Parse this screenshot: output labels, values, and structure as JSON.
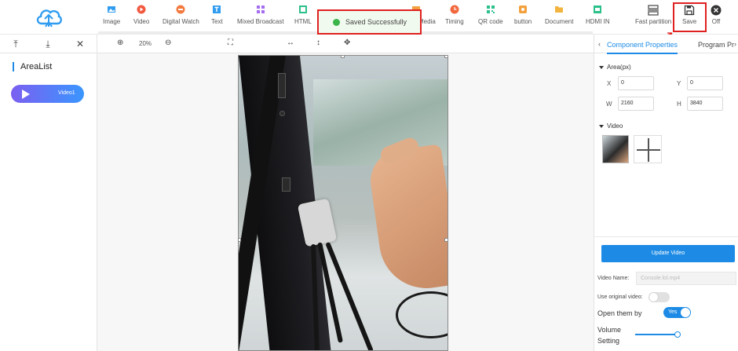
{
  "toolbar": {
    "items": [
      {
        "label": "Image",
        "icon": "image-icon",
        "color": "#2f9cf0"
      },
      {
        "label": "Video",
        "icon": "video-icon",
        "color": "#f2583e"
      },
      {
        "label": "Digital Watch",
        "icon": "digital-watch-icon",
        "color": "#f27a3e"
      },
      {
        "label": "Text",
        "icon": "text-icon",
        "color": "#2f9cf0"
      },
      {
        "label": "Mixed Broadcast",
        "icon": "mixed-broadcast-icon",
        "color": "#a66df0"
      },
      {
        "label": "HTML",
        "icon": "html-icon",
        "color": "#2cc08a"
      },
      {
        "label": "Stream Media",
        "icon": "stream-media-icon",
        "color": "#f2a13e"
      },
      {
        "label": "Timing",
        "icon": "timing-icon",
        "color": "#f2683e"
      },
      {
        "label": "QR code",
        "icon": "qr-code-icon",
        "color": "#2cc08a"
      },
      {
        "label": "button",
        "icon": "button-icon",
        "color": "#f2a13e"
      },
      {
        "label": "Document",
        "icon": "document-icon",
        "color": "#f2b43e"
      },
      {
        "label": "HDMI IN",
        "icon": "hdmi-in-icon",
        "color": "#2cc08a"
      }
    ],
    "fast_partition": "Fast partition",
    "save": "Save",
    "off": "Off"
  },
  "toast": {
    "message": "Saved Successfully"
  },
  "left_panel": {
    "title": "AreaList",
    "item": "Video1"
  },
  "canvas_tools": {
    "zoom": "20%"
  },
  "right_panel": {
    "tab_active": "Component Properties",
    "tab_other": "Program Pr",
    "area_section": "Area(px)",
    "x_label": "X",
    "x_value": "0",
    "y_label": "Y",
    "y_value": "0",
    "w_label": "W",
    "w_value": "2160",
    "h_label": "H",
    "h_value": "3840",
    "video_section": "Video",
    "update_button": "Update Video",
    "video_name_label": "Video Name:",
    "video_name_placeholder": "Console.lol.mp4",
    "use_original_label": "Use original video:",
    "open_them_by_label": "Open them by",
    "open_them_by_value": "Yes",
    "volume_label_1": "Volume",
    "volume_label_2": "Setting",
    "volume_level": 1.0
  },
  "colors": {
    "accent": "#1d8be5",
    "highlight": "#e02020",
    "success": "#39b54a"
  }
}
